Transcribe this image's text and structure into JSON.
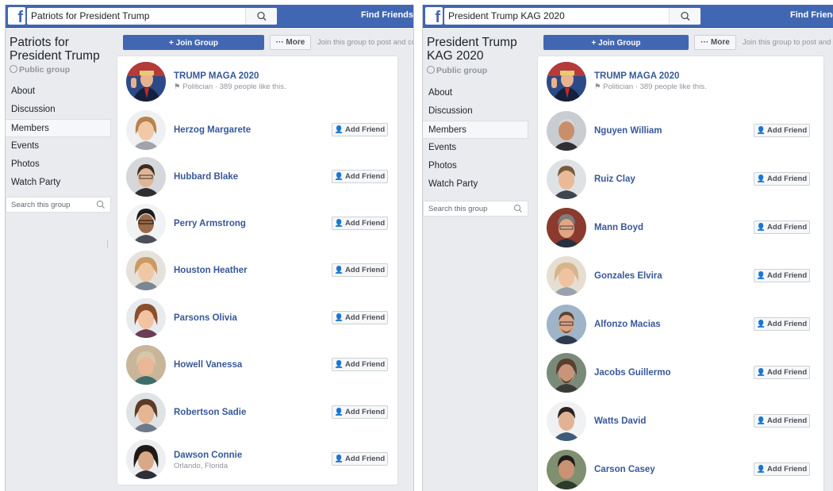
{
  "colors": {
    "facebook_blue": "#4267b2",
    "link_blue": "#385898",
    "page_bg": "#e9ebee"
  },
  "panels": [
    {
      "search_value": "Patriots for President Trump",
      "find_friends": "Find Friends",
      "group_name": "Patriots for President Trump",
      "group_type": "Public group",
      "nav": [
        "About",
        "Discussion",
        "Members",
        "Events",
        "Photos",
        "Watch Party"
      ],
      "active_nav": "Members",
      "sidebar_search_placeholder": "Search this group",
      "join_label": "+ Join Group",
      "more_label": "··· More",
      "join_hint": "Join this group to post and co",
      "page": {
        "name": "TRUMP MAGA 2020",
        "sub": "Politician · 389 people like this."
      },
      "add_friend_label": "Add Friend",
      "members": [
        {
          "name": "Herzog Margarete"
        },
        {
          "name": "Hubbard Blake"
        },
        {
          "name": "Perry Armstrong"
        },
        {
          "name": "Houston Heather"
        },
        {
          "name": "Parsons Olivia"
        },
        {
          "name": "Howell Vanessa"
        },
        {
          "name": "Robertson Sadie"
        },
        {
          "name": "Dawson Connie",
          "sub": "Orlando, Florida"
        }
      ]
    },
    {
      "search_value": "President Trump KAG 2020",
      "find_friends": "Find Friends",
      "group_name": "President Trump KAG 2020",
      "group_type": "Public group",
      "nav": [
        "About",
        "Discussion",
        "Members",
        "Events",
        "Photos",
        "Watch Party"
      ],
      "active_nav": "Members",
      "sidebar_search_placeholder": "Search this group",
      "join_label": "+ Join Group",
      "more_label": "··· More",
      "join_hint": "Join this group to post and",
      "page": {
        "name": "TRUMP MAGA 2020",
        "sub": "Politician · 389 people like this."
      },
      "add_friend_label": "Add Friend",
      "members": [
        {
          "name": "Nguyen William"
        },
        {
          "name": "Ruiz Clay"
        },
        {
          "name": "Mann Boyd"
        },
        {
          "name": "Gonzales Elvira"
        },
        {
          "name": "Alfonzo Macias"
        },
        {
          "name": "Jacobs Guillermo"
        },
        {
          "name": "Watts David"
        },
        {
          "name": "Carson Casey"
        }
      ]
    }
  ]
}
